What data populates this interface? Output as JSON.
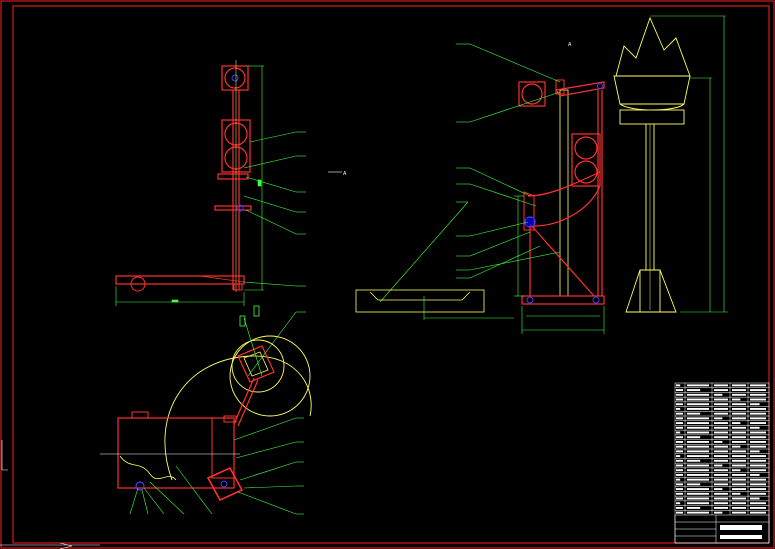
{
  "drawing": {
    "background": "#000000",
    "colors": {
      "border": "#ff2020",
      "part": "#ff3030",
      "leader": "#40ff40",
      "outline": "#ffff60",
      "dim": "#ffffff",
      "hatch": "#0000ff"
    },
    "view_marks": [
      "A",
      "A"
    ],
    "title_block": {
      "rows": 28,
      "columns": 4
    }
  }
}
